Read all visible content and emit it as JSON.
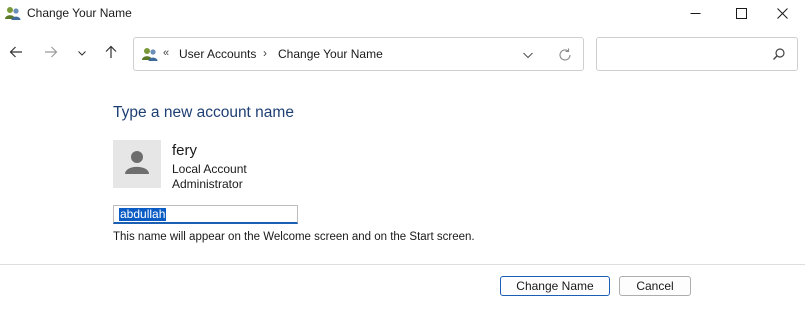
{
  "window": {
    "title": "Change Your Name",
    "icon": "user-accounts-icon",
    "controls": [
      "minimize-icon",
      "maximize-icon",
      "close-icon"
    ]
  },
  "navigation": {
    "back": "arrow-left-icon",
    "forward": "arrow-right-icon",
    "recent": "chevron-down-icon",
    "up": "arrow-up-icon"
  },
  "address": {
    "overflow": "«",
    "crumbs": [
      "User Accounts",
      "Change Your Name"
    ],
    "separator": "›"
  },
  "search": {
    "value": "",
    "placeholder": ""
  },
  "main": {
    "heading": "Type a new account name",
    "user": {
      "name": "fery",
      "account_type": "Local Account",
      "role": "Administrator"
    },
    "new_name": "abdullah",
    "hint": "This name will appear on the Welcome screen and on the Start screen."
  },
  "footer": {
    "change_label": "Change Name",
    "cancel_label": "Cancel"
  },
  "colors": {
    "heading": "#1e3f73",
    "selection": "#0a5bc4",
    "accent": "#1a5fb4"
  }
}
